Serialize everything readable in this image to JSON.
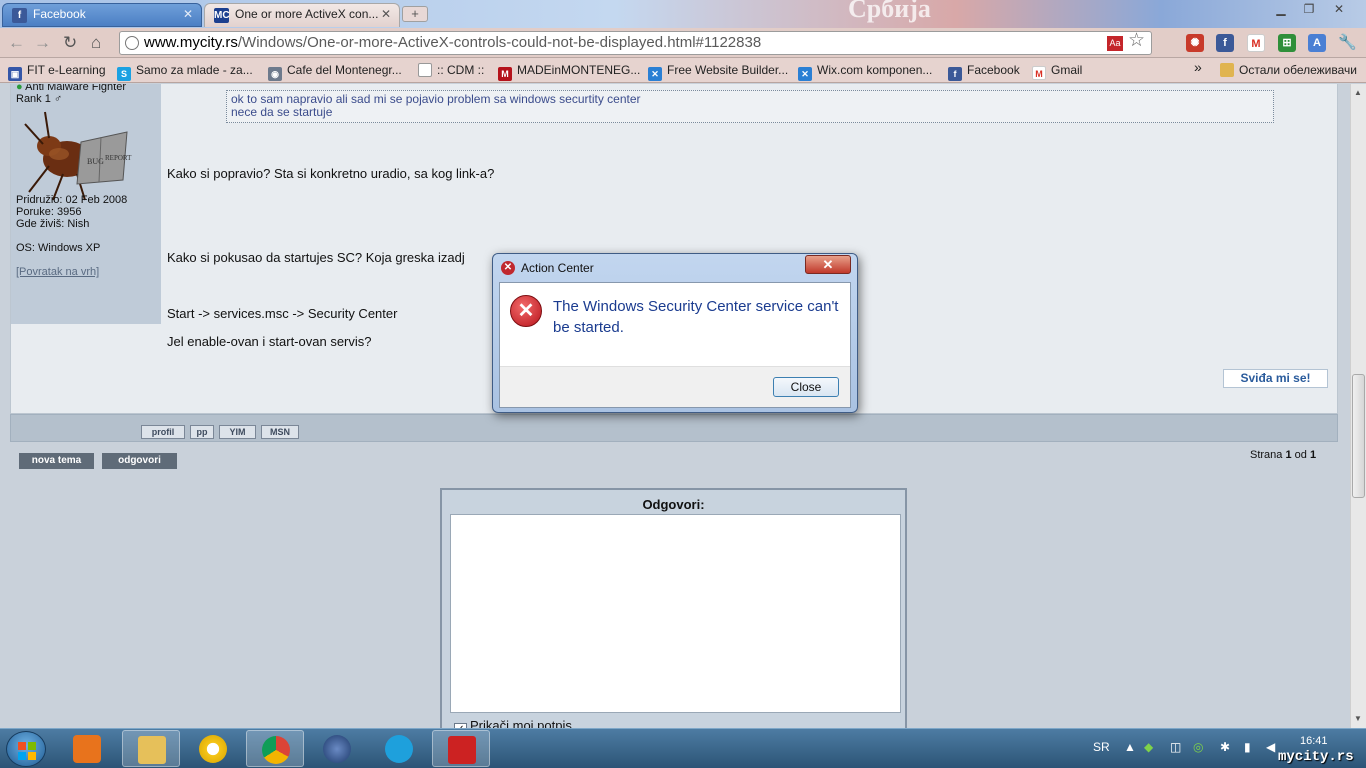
{
  "browser": {
    "tabs": [
      {
        "label": "Facebook",
        "icon": "facebook-icon"
      },
      {
        "label": "One or more ActiveX con...",
        "icon": "mycity-icon"
      }
    ],
    "flag_text": "Србија",
    "url_host": "www.mycity.rs",
    "url_path": "/Windows/One-or-more-ActiveX-controls-could-not-be-displayed.html#1122838",
    "bookmarks": [
      "FIT e-Learning",
      "Samo za mlade - za...",
      "Cafe del Montenegr...",
      ":: CDM ::",
      "MADEinMONTENEG...",
      "Free Website Builder...",
      "Wix.com komponen...",
      "Facebook",
      "Gmail"
    ],
    "bookmarks_more": "»",
    "other_bookmarks": "Остали обележивачи"
  },
  "post": {
    "user": {
      "title": "Anti Malware Fighter",
      "rank": "Rank 1 ♂",
      "joined": "Pridružio: 02 Feb 2008",
      "posts": "Poruke: 3956",
      "location": "Gde živiš: Nish",
      "os": "OS: Windows XP",
      "back_link": "[Povratak na vrh]"
    },
    "quote_line1": "ok to sam napravio ali sad mi se pojavio problem sa windows securtity center",
    "quote_line2": "nece da se startuje",
    "lines": [
      "Kako si popravio? Sta si konkretno uradio, sa kog link-a?",
      "Kako si pokusao da startujes SC? Koja greska izadj",
      "Start -> services.msc -> Security Center",
      "Jel enable-ovan i start-ovan servis?"
    ],
    "like_button": "Sviđa mi se!",
    "footer_buttons": [
      "profil",
      "pp",
      "YIM",
      "MSN"
    ]
  },
  "actions": {
    "new_topic": "nova tema",
    "reply": "odgovori",
    "pages_prefix": "Strana",
    "page_current": "1",
    "pages_mid": "od",
    "page_total": "1"
  },
  "reply_box": {
    "title": "Odgovori:",
    "signature_label": "Prikači moj potpis"
  },
  "dialog": {
    "title": "Action Center",
    "close_x": "✕",
    "message": "The Windows Security Center service can't be started.",
    "button": "Close"
  },
  "taskbar": {
    "language": "SR",
    "time": "16:41",
    "watermark": "mycity.rs"
  }
}
